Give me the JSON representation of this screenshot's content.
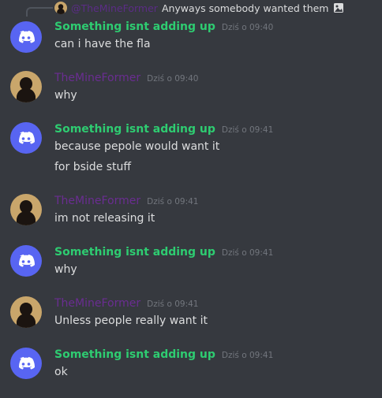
{
  "reply": {
    "author": "@TheMineFormer",
    "text": "Anyways somebody wanted them",
    "attachment_icon": "image-icon"
  },
  "users": {
    "a": {
      "name": "Something isnt adding up",
      "avatar": "discord-logo-icon",
      "color": "#2ecc71",
      "avatar_bg": "#5865f2"
    },
    "b": {
      "name": "TheMineFormer",
      "avatar": "silhouette-avatar-icon",
      "color": "#6a2d91",
      "avatar_bg": "#c9a66b"
    }
  },
  "messages": [
    {
      "author": "Something isnt adding up",
      "time": "Dziś o 09:40",
      "lines": [
        "can i have the fla"
      ]
    },
    {
      "author": "TheMineFormer",
      "time": "Dziś o 09:40",
      "lines": [
        "why"
      ]
    },
    {
      "author": "Something isnt adding up",
      "time": "Dziś o 09:41",
      "lines": [
        "because pepole would want it",
        "for bside stuff"
      ]
    },
    {
      "author": "TheMineFormer",
      "time": "Dziś o 09:41",
      "lines": [
        "im not releasing it"
      ]
    },
    {
      "author": "Something isnt adding up",
      "time": "Dziś o 09:41",
      "lines": [
        "why"
      ]
    },
    {
      "author": "TheMineFormer",
      "time": "Dziś o 09:41",
      "lines": [
        "Unless people really want it"
      ]
    },
    {
      "author": "Something isnt adding up",
      "time": "Dziś o 09:41",
      "lines": [
        "ok"
      ]
    }
  ]
}
